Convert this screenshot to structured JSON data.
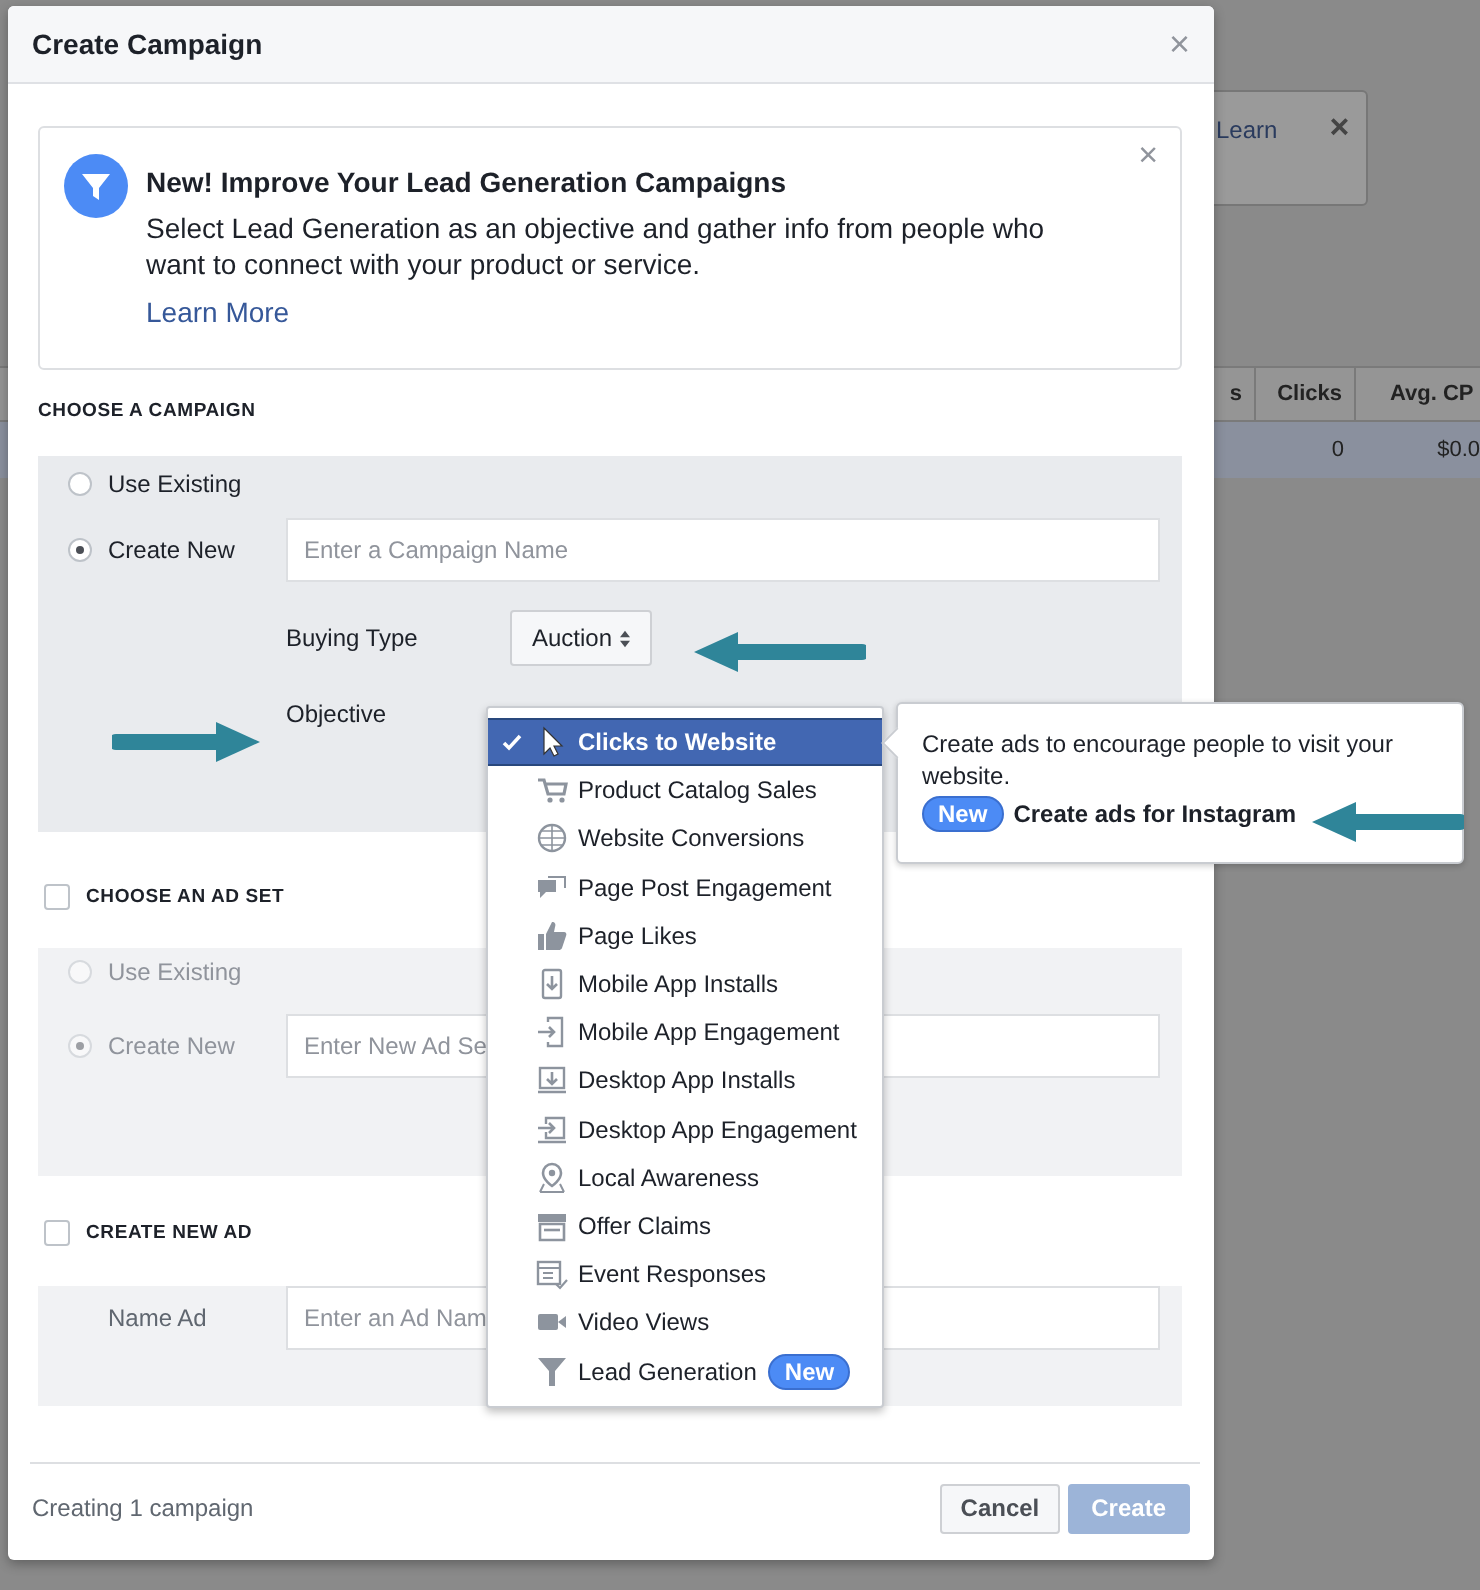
{
  "background_page": {
    "notice": {
      "link": "Learn",
      "close": "×"
    },
    "table": {
      "columns": [
        "s",
        "Clicks",
        "Avg. CP"
      ],
      "rows": [
        [
          "",
          "0",
          "$0.0"
        ]
      ]
    }
  },
  "dialog": {
    "title": "Create Campaign",
    "close": "×",
    "banner": {
      "title": "New! Improve Your Lead Generation Campaigns",
      "text": "Select Lead Generation as an objective and gather info from people who want to connect with your product or service.",
      "link": "Learn More",
      "close": "×"
    },
    "campaign": {
      "heading": "CHOOSE A CAMPAIGN",
      "options": [
        {
          "label": "Use Existing",
          "selected": false
        },
        {
          "label": "Create New",
          "selected": true
        }
      ],
      "name_field": {
        "placeholder": "Enter a Campaign Name"
      },
      "buying_type": {
        "label": "Buying Type",
        "value": "Auction"
      },
      "objective": {
        "label": "Objective"
      }
    },
    "ad_set": {
      "heading": "CHOOSE AN AD SET",
      "checked": false,
      "options": [
        {
          "label": "Use Existing",
          "selected": false,
          "disabled": true
        },
        {
          "label": "Create New",
          "selected": true,
          "disabled": true
        }
      ],
      "name_field": {
        "placeholder": "Enter New Ad Se"
      }
    },
    "ad": {
      "heading": "CREATE NEW AD",
      "checked": false,
      "name_label": "Name Ad",
      "name_field": {
        "placeholder": "Enter an Ad Nam"
      }
    },
    "footer": {
      "status": "Creating 1 campaign",
      "buttons": [
        {
          "label": "Cancel",
          "primary": false,
          "disabled": false
        },
        {
          "label": "Create",
          "primary": true,
          "disabled": true
        }
      ]
    }
  },
  "objective_menu": {
    "items": [
      {
        "label": "Clicks to Website",
        "selected": true
      },
      {
        "label": "Product Catalog Sales",
        "selected": false
      },
      {
        "label": "Website Conversions",
        "selected": false
      },
      {
        "label": "Page Post Engagement",
        "selected": false
      },
      {
        "label": "Page Likes",
        "selected": false
      },
      {
        "label": "Mobile App Installs",
        "selected": false
      },
      {
        "label": "Mobile App Engagement",
        "selected": false
      },
      {
        "label": "Desktop App Installs",
        "selected": false
      },
      {
        "label": "Desktop App Engagement",
        "selected": false
      },
      {
        "label": "Local Awareness",
        "selected": false
      },
      {
        "label": "Offer Claims",
        "selected": false
      },
      {
        "label": "Event Responses",
        "selected": false
      },
      {
        "label": "Video Views",
        "selected": false
      },
      {
        "label": "Lead Generation",
        "selected": false,
        "badge": "New"
      }
    ]
  },
  "tooltip": {
    "text": "Create ads to encourage people to visit your website.",
    "badge": "New",
    "link": "Create ads for Instagram"
  }
}
